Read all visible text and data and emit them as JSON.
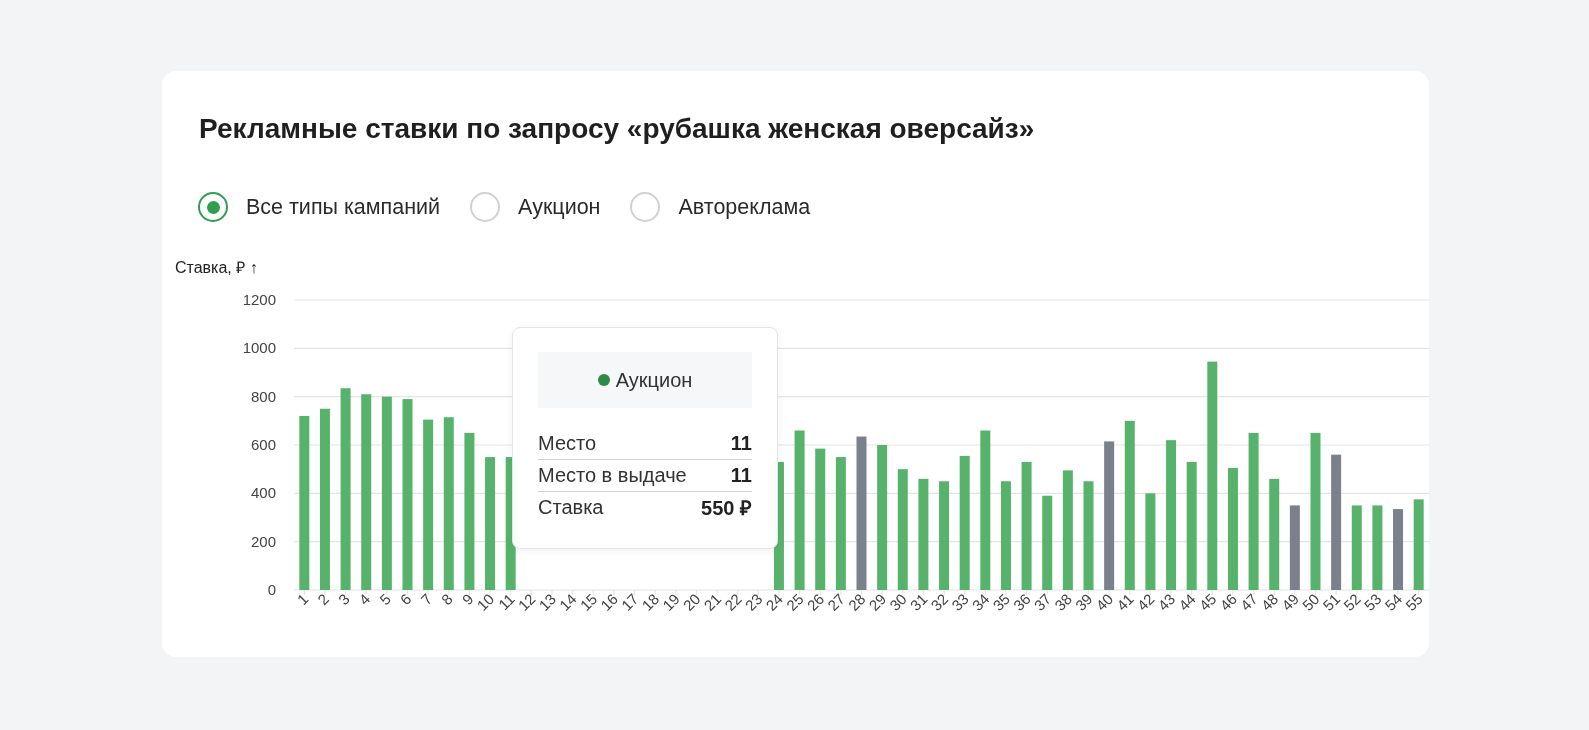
{
  "title": "Рекламные ставки по запросу «рубашка женская оверсайз»",
  "filters": [
    {
      "label": "Все типы кампаний",
      "selected": true
    },
    {
      "label": "Аукцион",
      "selected": false
    },
    {
      "label": "Автореклама",
      "selected": false
    }
  ],
  "chart_data": {
    "type": "bar",
    "ylabel": "Ставка, ₽ ↑",
    "categories": [
      "1",
      "2",
      "3",
      "4",
      "5",
      "6",
      "7",
      "8",
      "9",
      "10",
      "11",
      "12",
      "13",
      "14",
      "15",
      "16",
      "17",
      "18",
      "19",
      "20",
      "21",
      "22",
      "23",
      "24",
      "25",
      "26",
      "27",
      "28",
      "29",
      "30",
      "31",
      "32",
      "33",
      "34",
      "35",
      "36",
      "37",
      "38",
      "39",
      "40",
      "41",
      "42",
      "43",
      "44",
      "45",
      "46",
      "47",
      "48",
      "49",
      "50",
      "51",
      "52",
      "53",
      "54",
      "55"
    ],
    "grid": true,
    "ylim": [
      0,
      1200
    ],
    "yticks": [
      0,
      200,
      400,
      600,
      800,
      1000,
      1200
    ],
    "series": [
      {
        "color": "#57b36c",
        "values": [
          720,
          750,
          835,
          810,
          800,
          790,
          705,
          715,
          650,
          550,
          550,
          null,
          null,
          null,
          null,
          null,
          null,
          null,
          null,
          null,
          null,
          null,
          null,
          530,
          660,
          585,
          550,
          null,
          600,
          500,
          460,
          450,
          555,
          660,
          450,
          530,
          390,
          495,
          450,
          null,
          700,
          400,
          620,
          530,
          945,
          505,
          650,
          460,
          null,
          650,
          null,
          350,
          350,
          null,
          375
        ]
      },
      {
        "color": "#7b818c",
        "values": [
          null,
          null,
          null,
          null,
          null,
          null,
          null,
          null,
          null,
          null,
          null,
          null,
          null,
          null,
          null,
          null,
          null,
          null,
          null,
          null,
          null,
          null,
          null,
          null,
          null,
          null,
          null,
          635,
          null,
          null,
          null,
          null,
          null,
          null,
          null,
          null,
          null,
          null,
          null,
          615,
          null,
          null,
          null,
          null,
          null,
          null,
          null,
          null,
          350,
          null,
          560,
          null,
          null,
          335,
          null
        ]
      }
    ]
  },
  "tooltip": {
    "series": "Аукцион",
    "color": "#2e8b47",
    "rows": [
      {
        "label": "Место",
        "value": "11"
      },
      {
        "label": "Место в выдаче",
        "value": "11"
      },
      {
        "label": "Ставка",
        "value": "550 ₽"
      }
    ]
  }
}
